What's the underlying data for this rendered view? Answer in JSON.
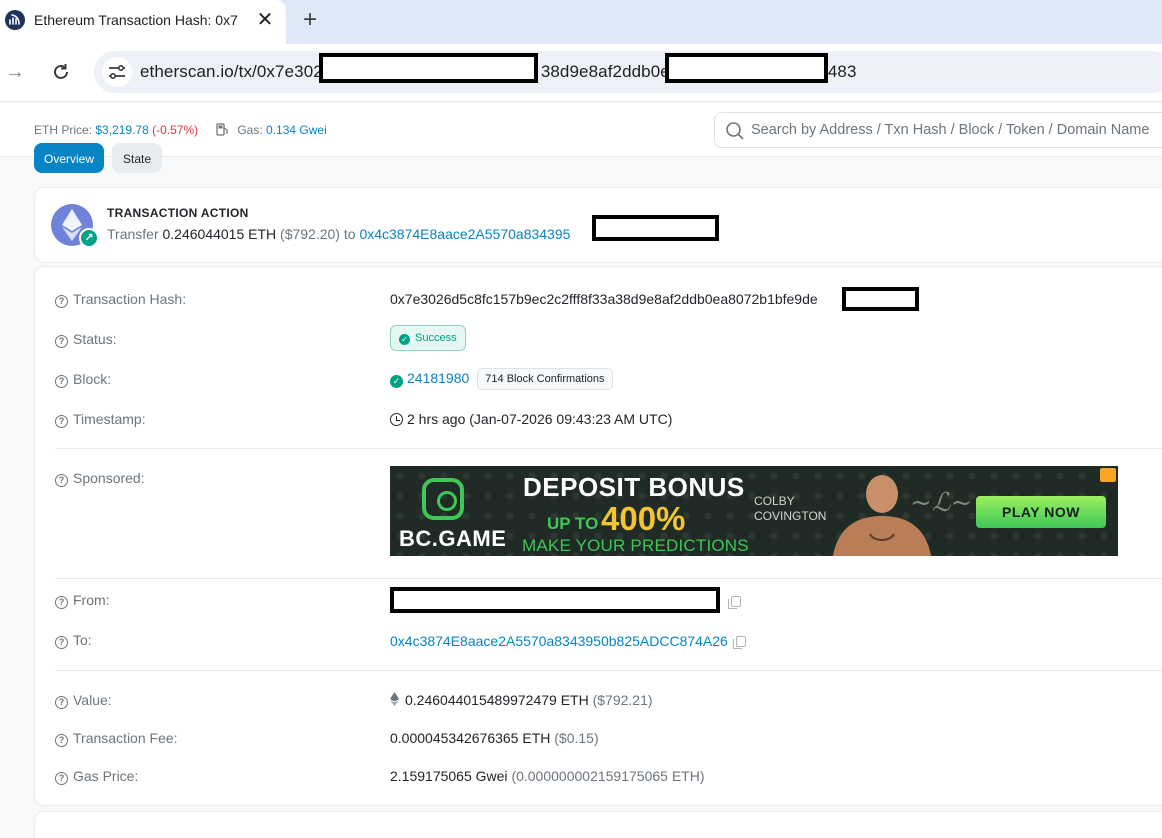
{
  "browser": {
    "tab_title": "Ethereum Transaction Hash: 0x7",
    "close_glyph": "✕",
    "new_tab_glyph": "+",
    "url_parts": [
      "etherscan.io/tx/0x7e302",
      "38d9e8af2ddb0e",
      "483"
    ],
    "url_full_placeholder": "etherscan.io/tx/0x7e302…38d9e8af2ddb0e…483"
  },
  "topbar": {
    "eth_price_label": "ETH Price:",
    "eth_price_value": "$3,219.78",
    "eth_price_change": "(-0.57%)",
    "gas_label": "Gas:",
    "gas_value": "0.134 Gwei",
    "search_placeholder": "Search by Address / Txn Hash / Block / Token / Domain Name"
  },
  "tabs": {
    "overview": "Overview",
    "state": "State"
  },
  "action": {
    "title": "TRANSACTION ACTION",
    "verb": "Transfer",
    "amount": "0.246044015 ETH",
    "usd": "($792.20)",
    "to_word": "to",
    "to_address": "0x4c3874E8aace2A5570a834395"
  },
  "details": {
    "hash_label": "Transaction Hash:",
    "hash_value": "0x7e3026d5c8fc157b9ec2c2fff8f33a38d9e8af2ddb0ea8072b1bfe9de",
    "status_label": "Status:",
    "status_value": "Success",
    "block_label": "Block:",
    "block_value": "24181980",
    "block_confirmations": "714 Block Confirmations",
    "timestamp_label": "Timestamp:",
    "timestamp_value": "2 hrs ago (Jan-07-2026 09:43:23 AM UTC)",
    "sponsored_label": "Sponsored:",
    "from_label": "From:",
    "to_label": "To:",
    "to_value": "0x4c3874E8aace2A5570a8343950b825ADCC874A26",
    "value_label": "Value:",
    "value_eth": "0.246044015489972479 ETH",
    "value_usd": "($792.21)",
    "fee_label": "Transaction Fee:",
    "fee_eth": "0.000045342676365 ETH",
    "fee_usd": "($0.15)",
    "gas_price_label": "Gas Price:",
    "gas_price_gwei": "2.159175065 Gwei",
    "gas_price_eth": "(0.000000002159175065 ETH)"
  },
  "ad": {
    "brand": "BC.GAME",
    "headline": "DEPOSIT BONUS",
    "up_to": "UP TO",
    "percent": "400%",
    "sub": "MAKE YOUR PREDICTIONS",
    "name_line1": "COLBY",
    "name_line2": "COVINGTON",
    "cta": "PLAY NOW"
  },
  "colors": {
    "link": "#0784c3",
    "success": "#00a186",
    "ad_green": "#3ec756",
    "ad_gold": "#f6c433"
  }
}
